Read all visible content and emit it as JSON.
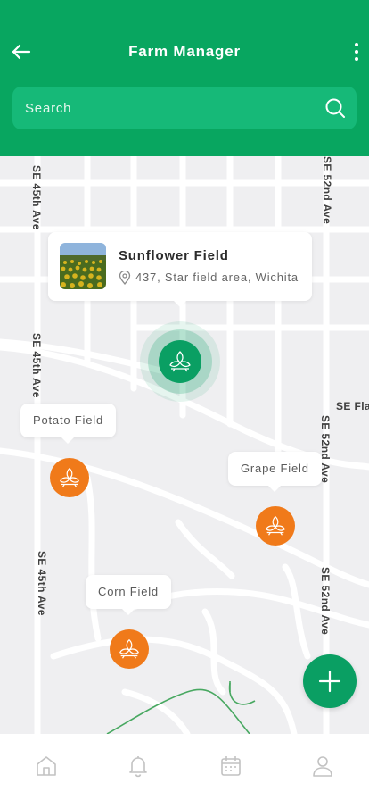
{
  "header": {
    "title": "Farm Manager",
    "back_icon": "arrow-left-icon",
    "more_icon": "more-vertical-icon"
  },
  "search": {
    "placeholder": "Search",
    "icon": "search-icon"
  },
  "map": {
    "streets": [
      "SE 45th Ave",
      "SE 45th Ave",
      "SE 45th Ave",
      "SE 52nd Ave",
      "SE 52nd Ave",
      "SE 52nd Ave",
      "SE Fla"
    ],
    "selected_field": {
      "name": "Sunflower Field",
      "address": "437, Star field area, Wichita"
    },
    "fields": [
      {
        "label": "Potato Field",
        "marker_color": "#f07a1a"
      },
      {
        "label": "Grape Field",
        "marker_color": "#f07a1a"
      },
      {
        "label": "Corn Field",
        "marker_color": "#f07a1a"
      }
    ],
    "selected_marker_color": "#0a9f63"
  },
  "fab": {
    "icon": "plus-icon"
  },
  "bottom_nav": [
    {
      "icon": "home-icon"
    },
    {
      "icon": "bell-icon"
    },
    {
      "icon": "calendar-icon"
    },
    {
      "icon": "user-icon"
    }
  ],
  "colors": {
    "primary": "#08a660",
    "search_bg": "#16b978",
    "accent_orange": "#f07a1a"
  }
}
